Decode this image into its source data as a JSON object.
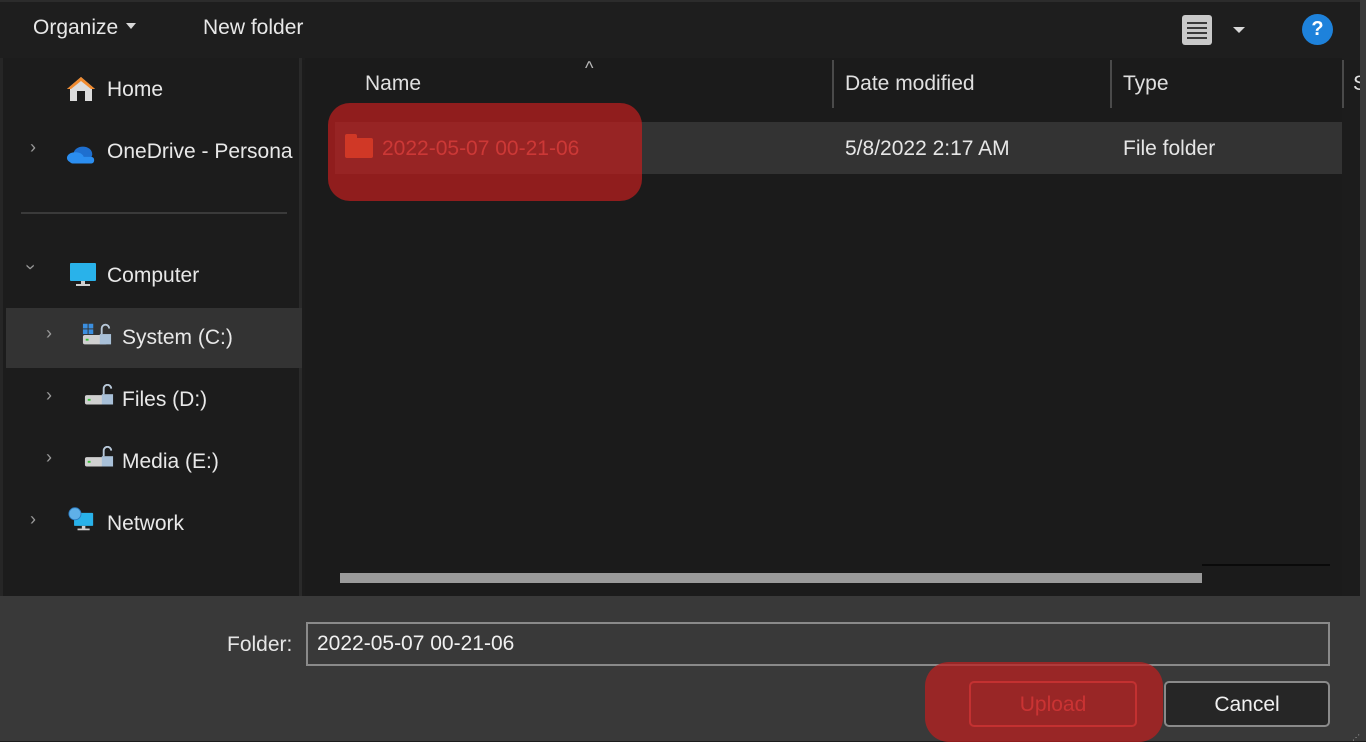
{
  "toolbar": {
    "organize_label": "Organize",
    "new_folder_label": "New folder",
    "view_icon": "details-view-icon",
    "help_icon": "help-icon",
    "help_glyph": "?"
  },
  "nav": {
    "items": [
      {
        "label": "Home",
        "icon": "home-icon",
        "expandable": false
      },
      {
        "label": "OneDrive - Persona",
        "icon": "onedrive-cloud-icon",
        "expandable": true,
        "expanded": false
      },
      {
        "label": "Computer",
        "icon": "computer-monitor-icon",
        "expandable": true,
        "expanded": true
      },
      {
        "label": "System (C:)",
        "icon": "system-drive-icon",
        "expandable": true,
        "expanded": false,
        "selected": true
      },
      {
        "label": "Files (D:)",
        "icon": "drive-icon",
        "expandable": true,
        "expanded": false
      },
      {
        "label": "Media (E:)",
        "icon": "drive-icon",
        "expandable": true,
        "expanded": false
      },
      {
        "label": "Network",
        "icon": "network-icon",
        "expandable": true,
        "expanded": false
      }
    ]
  },
  "file_list": {
    "columns": [
      "Name",
      "Date modified",
      "Type",
      "S"
    ],
    "sort_column": "Name",
    "sort_direction": "ascending",
    "rows": [
      {
        "name": "2022-05-07 00-21-06",
        "date_modified": "5/8/2022 2:17 AM",
        "type": "File folder",
        "icon": "folder-icon",
        "selected": true
      }
    ]
  },
  "footer": {
    "folder_label": "Folder:",
    "folder_value": "2022-05-07 00-21-06",
    "upload_label": "Upload",
    "cancel_label": "Cancel"
  },
  "colors": {
    "highlight": "#be1e1e",
    "folder": "#ff7a3a",
    "help": "#1e82db"
  }
}
